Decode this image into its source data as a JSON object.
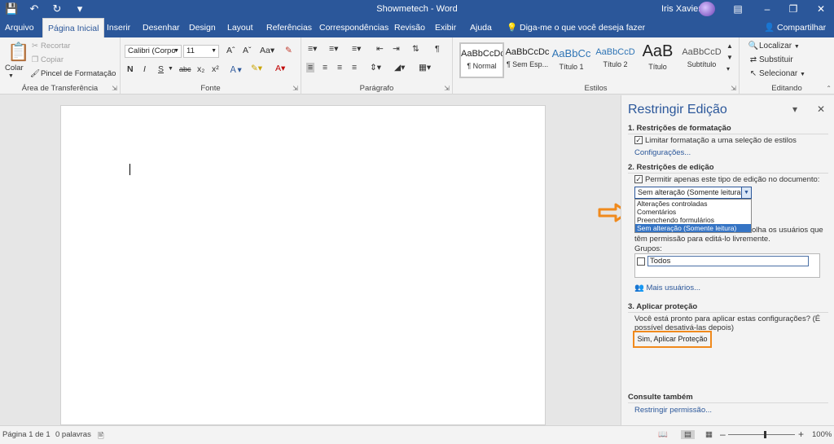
{
  "window": {
    "title": "Showmetech - Word",
    "user_name": "Iris Xavier"
  },
  "quick_access": [
    "save-icon",
    "undo-icon",
    "redo-icon",
    "customize-icon"
  ],
  "tabs": [
    {
      "label": "Arquivo",
      "active": false
    },
    {
      "label": "Página Inicial",
      "active": true
    },
    {
      "label": "Inserir",
      "active": false
    },
    {
      "label": "Desenhar",
      "active": false
    },
    {
      "label": "Design",
      "active": false
    },
    {
      "label": "Layout",
      "active": false
    },
    {
      "label": "Referências",
      "active": false
    },
    {
      "label": "Correspondências",
      "active": false
    },
    {
      "label": "Revisão",
      "active": false
    },
    {
      "label": "Exibir",
      "active": false
    },
    {
      "label": "Ajuda",
      "active": false
    }
  ],
  "tell_me": "Diga-me o que você deseja fazer",
  "share": "Compartilhar",
  "ribbon": {
    "clipboard": {
      "label": "Área de Transferência",
      "paste": "Colar",
      "cut": "Recortar",
      "copy": "Copiar",
      "format_painter": "Pincel de Formatação"
    },
    "font": {
      "label": "Fonte",
      "font_name": "Calibri (Corpo",
      "font_size": "11",
      "bold": "N",
      "italic": "I",
      "underline": "S",
      "strike": "abc",
      "subscript": "x₂",
      "superscript": "x²"
    },
    "paragraph": {
      "label": "Parágrafo"
    },
    "styles": {
      "label": "Estilos",
      "items": [
        {
          "sample": "AaBbCcDc",
          "name": "¶ Normal"
        },
        {
          "sample": "AaBbCcDc",
          "name": "¶ Sem Esp..."
        },
        {
          "sample": "AaBbCc",
          "name": "Título 1"
        },
        {
          "sample": "AaBbCcD",
          "name": "Título 2"
        },
        {
          "sample": "AaB",
          "name": "Título"
        },
        {
          "sample": "AaBbCcD",
          "name": "Subtítulo"
        }
      ]
    },
    "editing": {
      "label": "Editando",
      "find": "Localizar",
      "replace": "Substituir",
      "select": "Selecionar"
    }
  },
  "pane": {
    "title": "Restringir Edição",
    "section1": {
      "heading": "1. Restrições de formatação",
      "checkbox_label": "Limitar formatação a uma seleção de estilos",
      "link": "Configurações..."
    },
    "section2": {
      "heading": "2. Restrições de edição",
      "checkbox_label": "Permitir apenas este tipo de edição no documento:",
      "selected_value": "Sem alteração (Somente leitura)",
      "options": [
        "Alterações controladas",
        "Comentários",
        "Preenchendo formulários",
        "Sem alteração (Somente leitura)"
      ],
      "exceptions_fragment": "olha os usuários que",
      "exceptions_line2": "têm permissão para editá-lo livremente.",
      "groups_label": "Grupos:",
      "group_entry": "Todos",
      "more_users": "Mais usuários..."
    },
    "section3": {
      "heading": "3. Aplicar proteção",
      "description": "Você está pronto para aplicar estas configurações? (É possível desativá-las depois)",
      "button": "Sim, Aplicar Proteção"
    },
    "see_also": {
      "heading": "Consulte também",
      "link": "Restringir permissão..."
    }
  },
  "status": {
    "page": "Página 1 de 1",
    "words": "0 palavras",
    "zoom": "100%"
  },
  "colors": {
    "word_blue": "#2b579a",
    "annotation_orange": "#f08a1d"
  }
}
